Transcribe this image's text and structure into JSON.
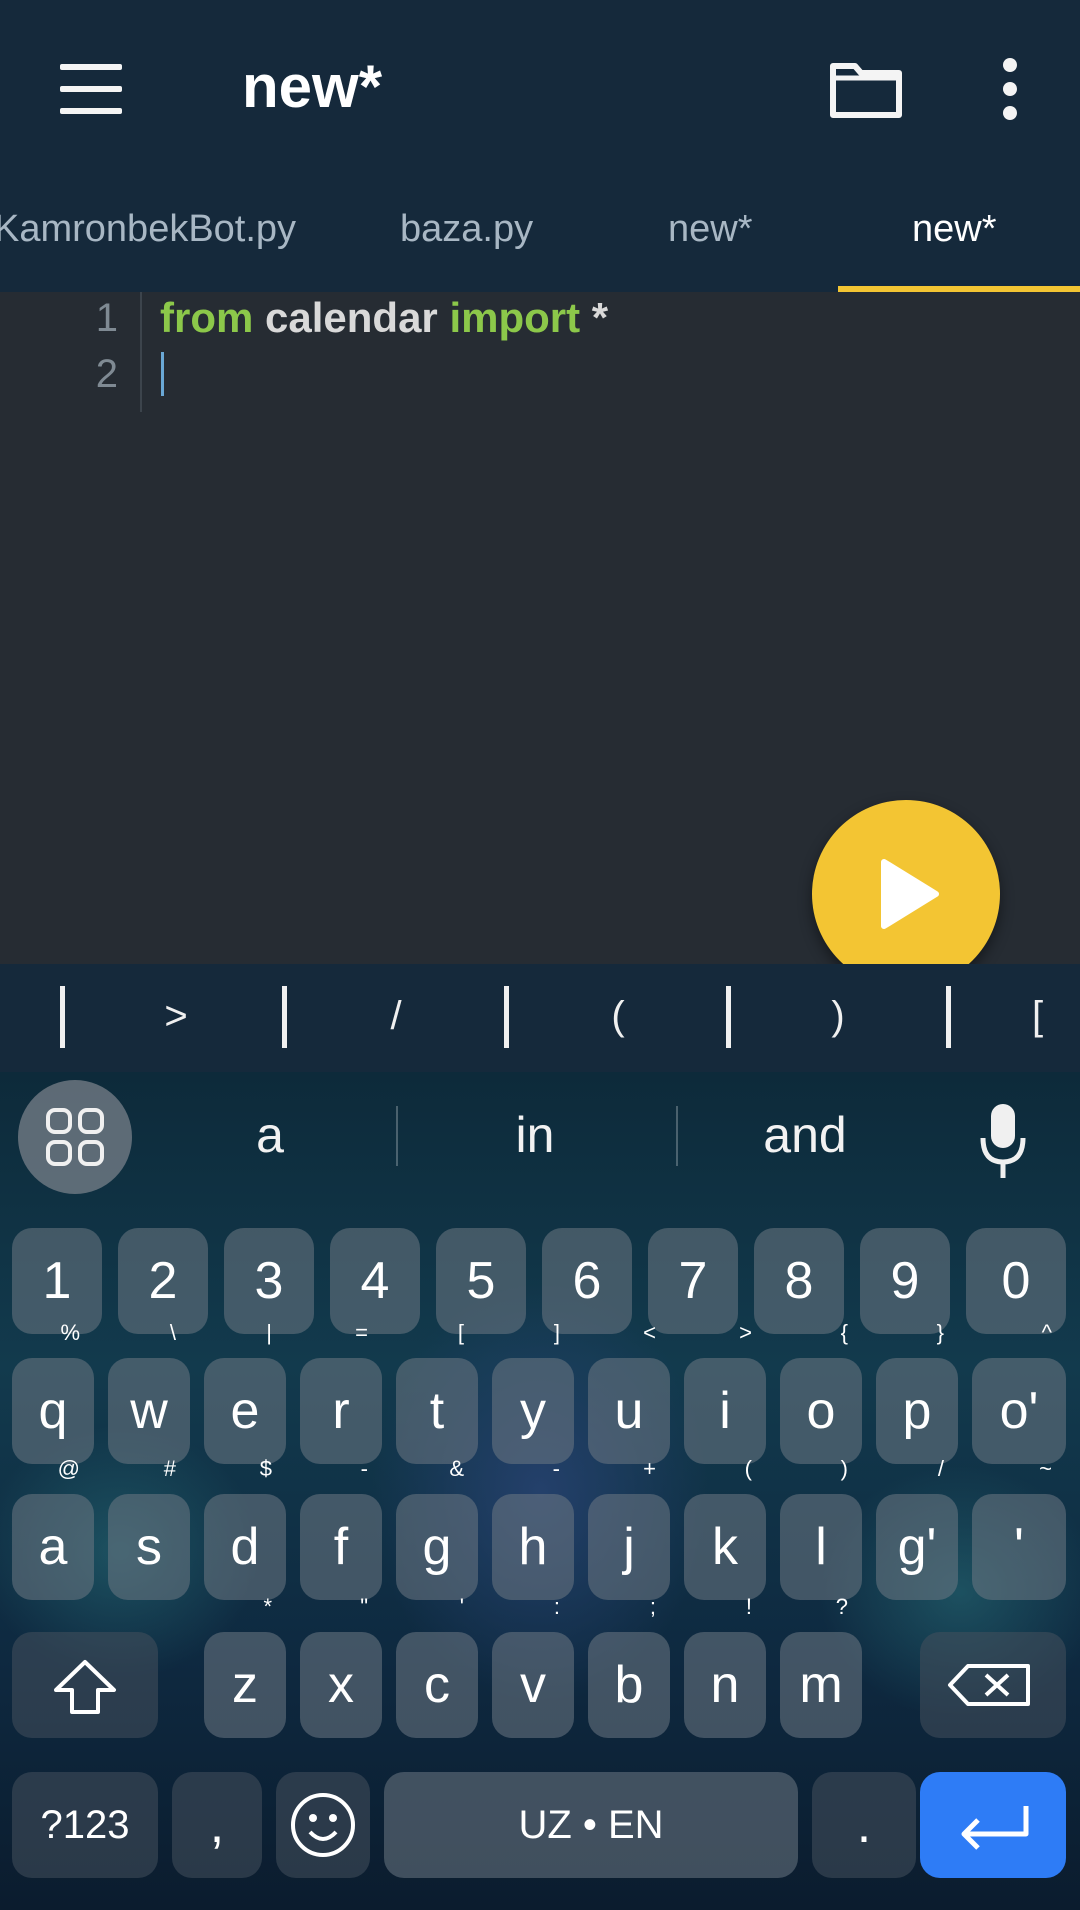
{
  "appbar": {
    "title": "new*"
  },
  "tabs": [
    {
      "label": "KamronbekBot.py",
      "active": false
    },
    {
      "label": "baza.py",
      "active": false
    },
    {
      "label": "new*",
      "active": false
    },
    {
      "label": "new*",
      "active": true
    }
  ],
  "editor": {
    "line_numbers": [
      "1",
      "2"
    ],
    "line1": {
      "kw1": "from",
      "mod": "calendar",
      "kw2": "import",
      "rest": "*"
    }
  },
  "symbol_bar": {
    "symbols": [
      ">",
      "/",
      "(",
      ")",
      "["
    ]
  },
  "keyboard": {
    "suggestions": [
      "a",
      "in",
      "and"
    ],
    "number_row": [
      "1",
      "2",
      "3",
      "4",
      "5",
      "6",
      "7",
      "8",
      "9",
      "0"
    ],
    "row1": [
      {
        "k": "q",
        "h": "%"
      },
      {
        "k": "w",
        "h": "\\"
      },
      {
        "k": "e",
        "h": "|"
      },
      {
        "k": "r",
        "h": "="
      },
      {
        "k": "t",
        "h": "["
      },
      {
        "k": "y",
        "h": "]"
      },
      {
        "k": "u",
        "h": "<"
      },
      {
        "k": "i",
        "h": ">"
      },
      {
        "k": "o",
        "h": "{"
      },
      {
        "k": "p",
        "h": "}"
      },
      {
        "k": "o'",
        "h": "^"
      }
    ],
    "row2": [
      {
        "k": "a",
        "h": "@"
      },
      {
        "k": "s",
        "h": "#"
      },
      {
        "k": "d",
        "h": "$"
      },
      {
        "k": "f",
        "h": "-"
      },
      {
        "k": "g",
        "h": "&"
      },
      {
        "k": "h",
        "h": "-"
      },
      {
        "k": "j",
        "h": "+"
      },
      {
        "k": "k",
        "h": "("
      },
      {
        "k": "l",
        "h": ")"
      },
      {
        "k": "g'",
        "h": "/"
      },
      {
        "k": "'",
        "h": "~"
      }
    ],
    "row3": [
      {
        "k": "z",
        "h": "*"
      },
      {
        "k": "x",
        "h": "\""
      },
      {
        "k": "c",
        "h": "'"
      },
      {
        "k": "v",
        "h": ":"
      },
      {
        "k": "b",
        "h": ";"
      },
      {
        "k": "n",
        "h": "!"
      },
      {
        "k": "m",
        "h": "?"
      }
    ],
    "symbols_key": "?123",
    "comma_key": ",",
    "space_label": "UZ • EN",
    "period_key": "."
  },
  "colors": {
    "accent": "#f3c533",
    "keyword": "#8cc84a",
    "enter": "#2e7cf6",
    "bar": "#15293b"
  }
}
